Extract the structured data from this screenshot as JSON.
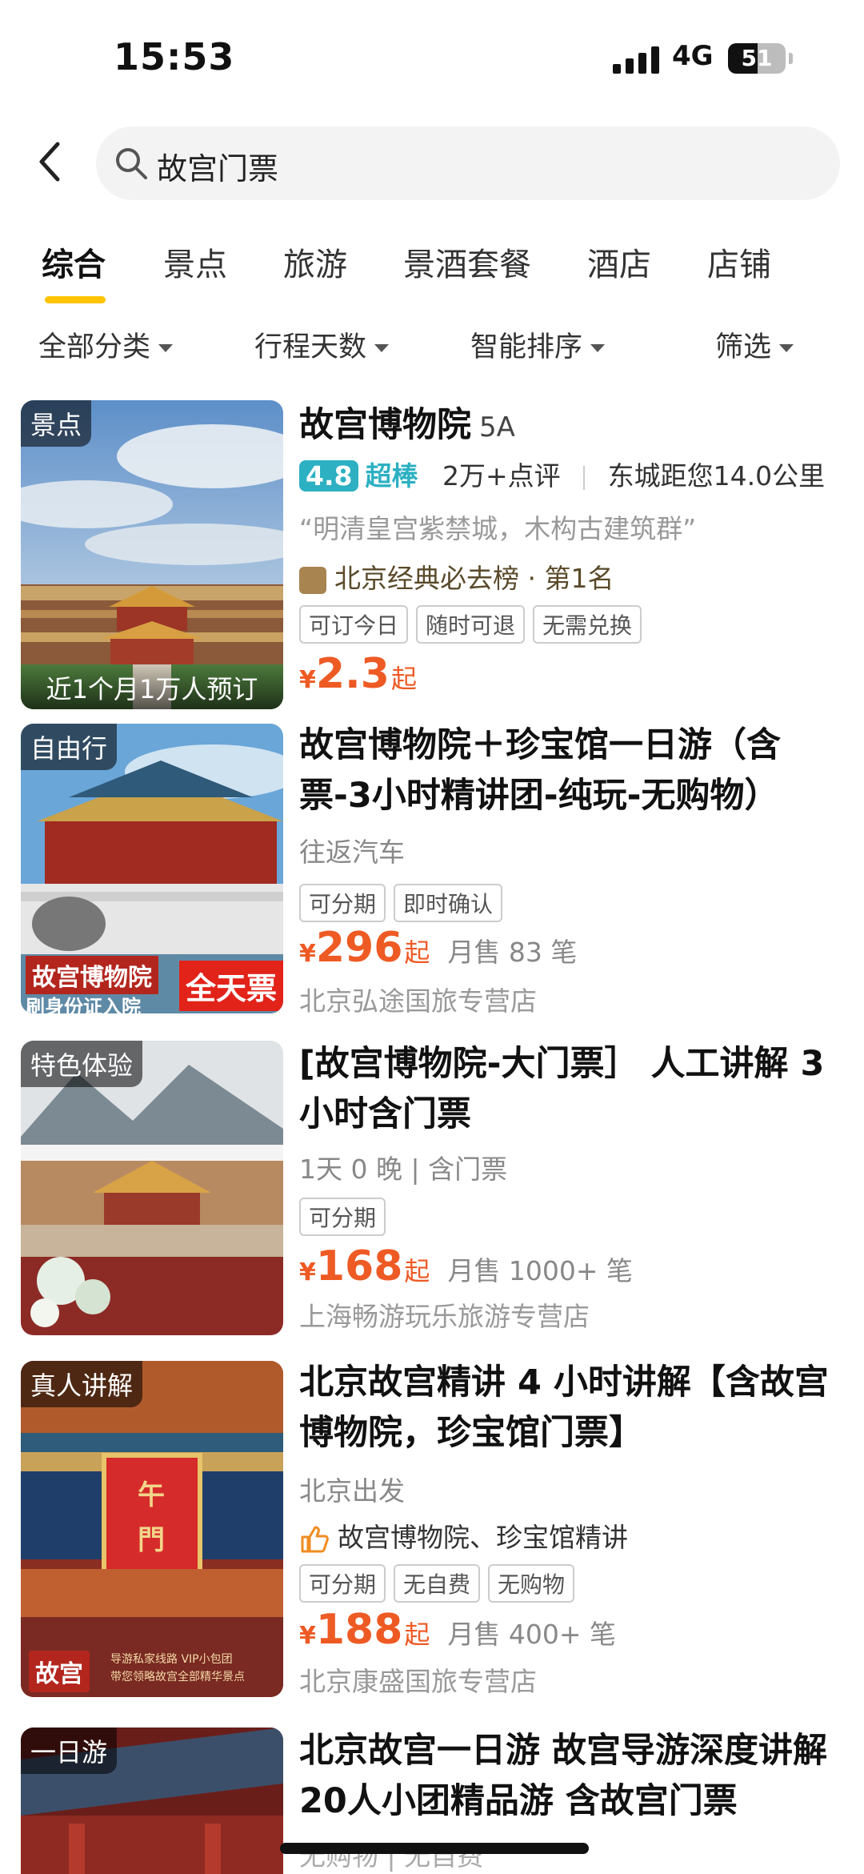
{
  "status": {
    "time": "15:53",
    "network": "4G",
    "battery": "51",
    "battery_level": 0.51
  },
  "search": {
    "query": "故宫门票"
  },
  "tabs": [
    {
      "label": "综合",
      "active": true
    },
    {
      "label": "景点"
    },
    {
      "label": "旅游"
    },
    {
      "label": "景酒套餐"
    },
    {
      "label": "酒店"
    },
    {
      "label": "店铺"
    }
  ],
  "filters": [
    "全部分类",
    "行程天数",
    "智能排序",
    "筛选"
  ],
  "colors": {
    "accent": "#ffc300",
    "price": "#ee5a24",
    "score": "#2cb0c2"
  },
  "results": [
    {
      "badge": "景点",
      "image_caption": "近1个月1万人预订",
      "title": "故宫博物院",
      "level": "5A",
      "score": "4.8",
      "grade": "超棒",
      "reviews": "2万+点评",
      "distance": "东城距您14.0公里",
      "quote": "“明清皇宫紫禁城，木构古建筑群”",
      "rank_icon": "ranking-badge-icon",
      "rank": "北京经典必去榜 · 第1名",
      "tags": [
        "可订今日",
        "随时可退",
        "无需兑换"
      ],
      "currency": "¥",
      "price": "2.3",
      "price_suffix": "起"
    },
    {
      "badge": "自由行",
      "image_text_1": "故宫博物院",
      "image_text_2": "刷身份证入院",
      "image_text_3": "全天票",
      "title": "故宫博物院＋珍宝馆一日游（含票-3小时精讲团-纯玩-无购物）",
      "subtitle": "往返汽车",
      "tags": [
        "可分期",
        "即时确认"
      ],
      "currency": "¥",
      "price": "296",
      "price_suffix": "起",
      "sold": "月售 83 笔",
      "shop": "北京弘途国旅专营店"
    },
    {
      "badge": "特色体验",
      "title": "[故宫博物院-大门票］ 人工讲解 3 小时含门票",
      "subtitle": "1天 0 晚 | 含门票",
      "tags": [
        "可分期"
      ],
      "currency": "¥",
      "price": "168",
      "price_suffix": "起",
      "sold": "月售 1000+ 笔",
      "shop": "上海畅游玩乐旅游专营店"
    },
    {
      "badge": "真人讲解",
      "image_text_1": "午",
      "image_text_2": "門",
      "image_text_3": "故宫",
      "image_text_4": "导游私家线路 VIP小包团",
      "image_text_5": "带您领略故宫全部精华景点",
      "title": "北京故宫精讲 4 小时讲解【含故宫博物院，珍宝馆门票】",
      "subtitle": "北京出发",
      "highlight_icon": "thumbs-up-icon",
      "highlight": "故宫博物院、珍宝馆精讲",
      "tags": [
        "可分期",
        "无自费",
        "无购物"
      ],
      "currency": "¥",
      "price": "188",
      "price_suffix": "起",
      "sold": "月售 400+ 笔",
      "shop": "北京康盛国旅专营店"
    },
    {
      "badge": "一日游",
      "title": "北京故宫一日游 故宫导游深度讲解20人小团精品游 含故宫门票",
      "subtitle": "无购物 | 无自费"
    }
  ]
}
